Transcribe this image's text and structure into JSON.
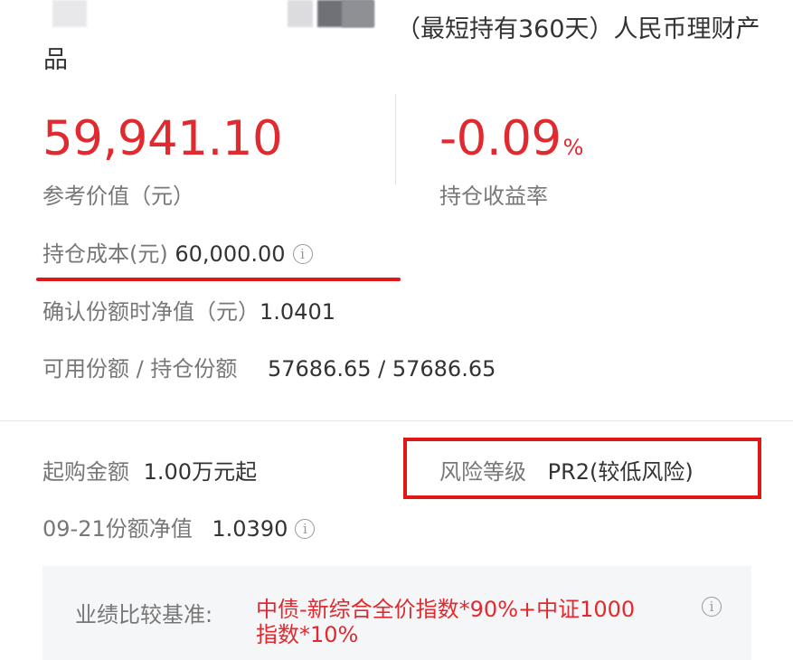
{
  "product": {
    "title_line1": "（最短持有360天）人民币理财产",
    "title_line2": "品"
  },
  "summary": {
    "reference_value": "59,941.10",
    "reference_value_label": "参考价值（元）",
    "return_rate": "-0.09",
    "return_rate_unit": "%",
    "return_rate_label": "持仓收益率"
  },
  "details": {
    "cost_label": "持仓成本(元)",
    "cost_value": "60,000.00",
    "nav_label": "确认份额时净值（元）",
    "nav_value": "1.0401",
    "shares_label": "可用份额 / 持仓份额",
    "shares_value": "57686.65 / 57686.65"
  },
  "info": {
    "min_purchase_label": "起购金额",
    "min_purchase_value": "1.00万元起",
    "risk_label": "风险等级",
    "risk_value": "PR2(较低风险)",
    "date_nav_label": "09-21份额净值",
    "date_nav_value": "1.0390"
  },
  "benchmark": {
    "label": "业绩比较基准:",
    "text": "中债-新综合全价指数*90%+中证1000指数*10%"
  },
  "icons": {
    "info": "i"
  },
  "colors": {
    "accent_red": "#e12a2f",
    "annotation_red": "#e01717"
  }
}
